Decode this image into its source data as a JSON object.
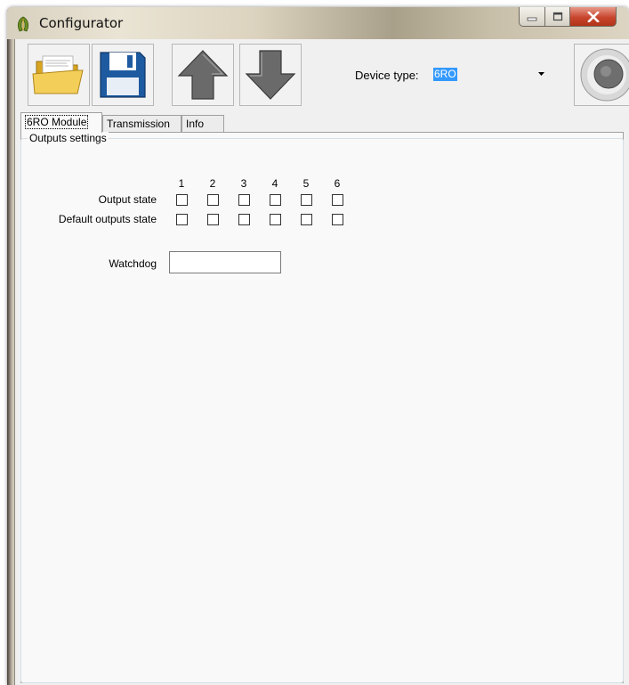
{
  "window": {
    "title": "Configurator",
    "app_icon": "leaf-icon",
    "caption_buttons": [
      "minimize-icon",
      "maximize-icon",
      "close-icon"
    ]
  },
  "toolbar": {
    "buttons": [
      {
        "name": "open-button",
        "icon": "open-folder-icon"
      },
      {
        "name": "save-button",
        "icon": "floppy-disk-icon"
      },
      {
        "name": "upload-button",
        "icon": "arrow-up-icon"
      },
      {
        "name": "download-button",
        "icon": "arrow-down-icon"
      }
    ],
    "device_type_label": "Device type:",
    "device_type_value": "6RO",
    "connect_icon": "connect-round-icon"
  },
  "tabs": [
    {
      "label": "6RO Module",
      "active": true
    },
    {
      "label": "Transmission",
      "active": false
    },
    {
      "label": "Info",
      "active": false
    }
  ],
  "outputs": {
    "group_title": "Outputs settings",
    "columns": [
      "1",
      "2",
      "3",
      "4",
      "5",
      "6"
    ],
    "rows": [
      {
        "label": "Output state",
        "checked": [
          false,
          false,
          false,
          false,
          false,
          false
        ]
      },
      {
        "label": "Default outputs state",
        "checked": [
          false,
          false,
          false,
          false,
          false,
          false
        ]
      }
    ],
    "watchdog_label": "Watchdog",
    "watchdog_value": ""
  },
  "colors": {
    "selection": "#3399ff",
    "panel_bg": "#f9f9f9",
    "window_bg": "#f0f0f0"
  }
}
